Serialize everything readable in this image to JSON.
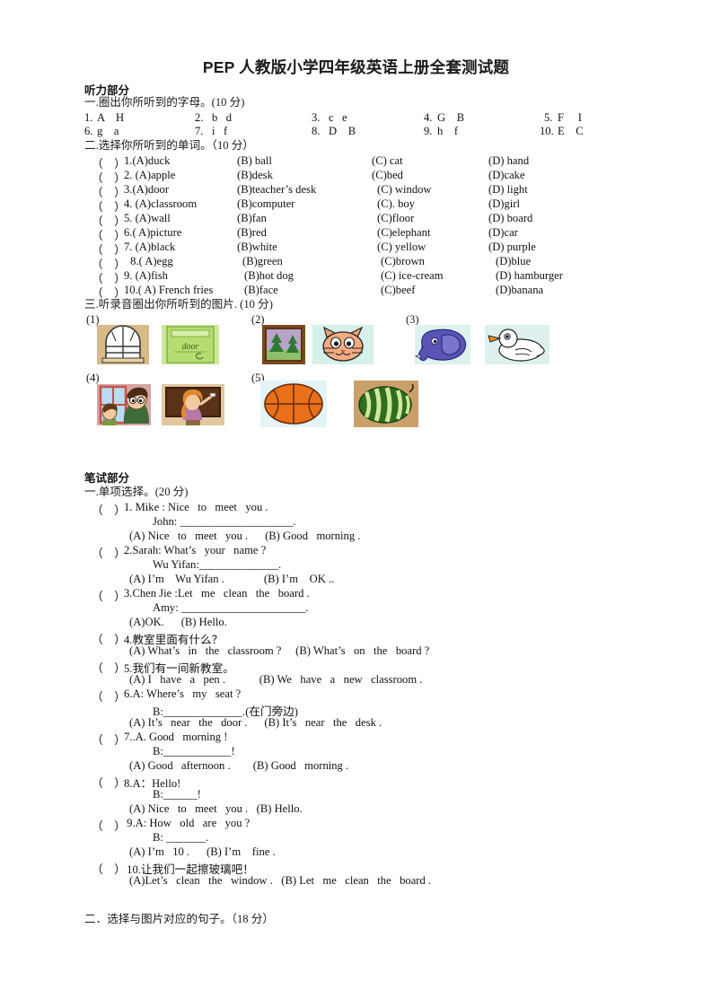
{
  "document": {
    "title": "PEP 人教版小学四年级英语上册全套测试题"
  },
  "listening": {
    "heading": "听力部分",
    "q1": {
      "prompt": "一.圈出你所听到的字母。(10 分)",
      "items": [
        {
          "num": "1.",
          "choices": "A    H"
        },
        {
          "num": "2.",
          "choices": "b   d"
        },
        {
          "num": "3.",
          "choices": "c   e"
        },
        {
          "num": "4.",
          "choices": "G    B"
        },
        {
          "num": "5.",
          "choices": "F     I"
        },
        {
          "num": "6.",
          "choices": "g    a"
        },
        {
          "num": "7.",
          "choices": "i   f"
        },
        {
          "num": "8.",
          "choices": "D    B"
        },
        {
          "num": "9.",
          "choices": "h    f"
        },
        {
          "num": "10.",
          "choices": "E    C"
        }
      ]
    },
    "q2": {
      "prompt": "二.选择你所听到的单词。（10 分）",
      "rows": [
        {
          "paren": "（    ）",
          "num": "1.",
          "a": "(A)duck",
          "b": "(B) ball",
          "c": "(C) cat",
          "d": "(D) hand"
        },
        {
          "paren": "（    ）",
          "num": "2. ",
          "a": "(A)apple",
          "b": "(B)desk",
          "c": "(C)bed",
          "d": "(D)cake"
        },
        {
          "paren": "（    ）",
          "num": "3.",
          "a": "(A)door",
          "b": "(B)teacher’s desk",
          "c": "(C) window",
          "d": "(D) light"
        },
        {
          "paren": "（    ）",
          "num": "4. ",
          "a": "(A)classroom",
          "b": "(B)computer",
          "c": "(C). boy",
          "d": "(D)girl"
        },
        {
          "paren": "（    ）",
          "num": "5. ",
          "a": "(A)wall",
          "b": "(B)fan",
          "c": "(C)floor",
          "d": "(D) board"
        },
        {
          "paren": "（    ）",
          "num": "6.( ",
          "a": "A)picture",
          "b": "(B)red",
          "c": "(C)elephant",
          "d": "(D)car"
        },
        {
          "paren": "（    ）",
          "num": "7. ",
          "a": "(A)black",
          "b": "(B)white",
          "c": "(C) yellow",
          "d": "(D) purple"
        },
        {
          "paren": "（    ）",
          "num": " 8.( ",
          "a": "A)egg",
          "b": "(B)green",
          "c": "(C)brown",
          "d": "(D)blue"
        },
        {
          "paren": "（    ）",
          "num": "9. ",
          "a": "(A)fish",
          "b": "(B)hot dog",
          "c": "(C) ice-cream",
          "d": "(D) hamburger"
        },
        {
          "paren": "（    ）",
          "num": "10.( ",
          "a": "A) French fries",
          "b": "(B)face",
          "c": "(C)beef",
          "d": "(D)banana"
        }
      ]
    },
    "q3": {
      "prompt": "三.听录音圈出你所听到的图片. (10 分)",
      "groups": [
        {
          "label": "(1)",
          "pictures": [
            "window",
            "door"
          ]
        },
        {
          "label": "(2)",
          "pictures": [
            "picture-of-trees",
            "cat-face"
          ]
        },
        {
          "label": "(3)",
          "pictures": [
            "elephant",
            "duck"
          ]
        },
        {
          "label": "(4)",
          "pictures": [
            "boy-looking-out-window",
            "girl-at-blackboard"
          ]
        },
        {
          "label": "(5)",
          "pictures": [
            "basketball",
            "watermelon"
          ]
        }
      ]
    }
  },
  "written": {
    "heading": "笔试部分",
    "q1": {
      "prompt": "一.单项选择。(20 分)",
      "items": [
        {
          "paren": "（    ）",
          "stem": "1. Mike : Nice   to   meet   you .",
          "stem2": "John: ____________________.",
          "options": "(A) Nice   to   meet   you .      (B) Good   morning ."
        },
        {
          "paren": "（    ）",
          "stem": "2.Sarah: What’s   your   name ?",
          "stem2": "Wu Yifan:______________.",
          "options": "(A) I’m    Wu Yifan .              (B) I’m    OK .."
        },
        {
          "paren": "（    ）",
          "stem": "3.Chen Jie :Let   me   clean   the   board .",
          "stem2": "Amy: ______________________.",
          "options": "(A)OK.      (B) Hello."
        },
        {
          "paren": "（    ）",
          "stem": "4.教室里面有什么？",
          "stem2": "",
          "options": "(A) What’s   in   the   classroom ?     (B) What’s   on   the   board ?"
        },
        {
          "paren": "（    ）",
          "stem": "5.我们有一间新教室。",
          "stem2": "",
          "options": "(A) I   have   a   pen .            (B) We   have   a   new   classroom ."
        },
        {
          "paren": "（    ）",
          "stem": "6.A: Where’s   my   seat ?",
          "stem2": "B:______________.(在门旁边)",
          "options": "(A) It’s   near   the   door .      (B) It’s   near   the   desk ."
        },
        {
          "paren": "（    ）",
          "stem": "7..A. Good   morning !",
          "stem2": "B:____________!",
          "options": "(A) Good   afternoon .        (B) Good   morning ."
        },
        {
          "paren": "（    ）",
          "stem": "8.A：Hello!",
          "stem2": "B:______!",
          "options": "(A) Nice   to   meet   you .   (B) Hello."
        },
        {
          "paren": "（    ）",
          "stem": " 9.A: How   old   are   you ?",
          "stem2": "B: _______.",
          "options": "(A) I’m   10 .      (B) I’m    fine ."
        },
        {
          "paren": "（    ）",
          "stem": " 10.让我们一起擦玻璃吧！",
          "stem2": "",
          "options": "(A)Let’s   clean   the   window .   (B) Let   me   clean   the   board ."
        }
      ]
    },
    "q2": {
      "prompt": "二．选择与图片对应的句子。（18 分）"
    }
  },
  "colors": {
    "text": "#1b1b1b",
    "window_frame": "#c8a86a",
    "door_green": "#b9dd7d",
    "cat_orange": "#f0a079",
    "elephant_blue": "#5a55b5",
    "basketball_orange": "#e8701a",
    "watermelon_green": "#2f6e21",
    "tree_green": "#2f7a33",
    "board_brown": "#5a3218"
  }
}
